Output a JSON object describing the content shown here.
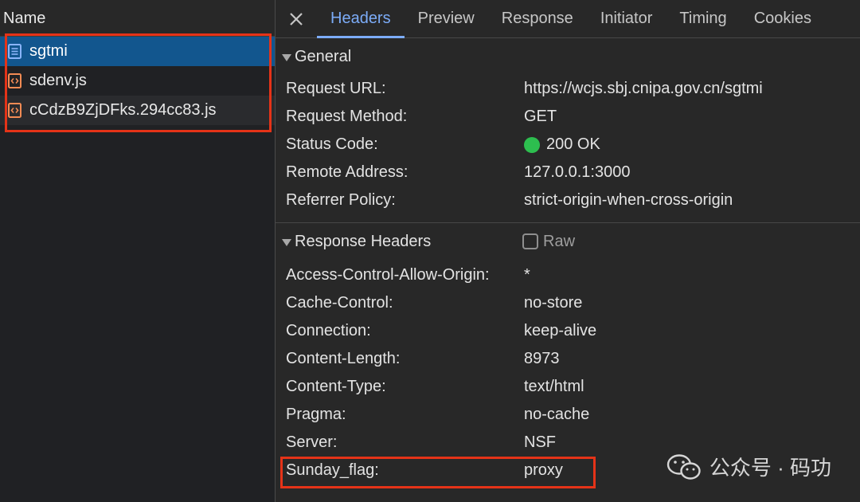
{
  "request_list": {
    "header": "Name",
    "items": [
      {
        "name": "sgtmi",
        "type": "document",
        "selected": true
      },
      {
        "name": "sdenv.js",
        "type": "script",
        "selected": false
      },
      {
        "name": "cCdzB9ZjDFks.294cc83.js",
        "type": "script",
        "selected": false
      }
    ]
  },
  "tabs": [
    {
      "label": "Headers",
      "active": true
    },
    {
      "label": "Preview",
      "active": false
    },
    {
      "label": "Response",
      "active": false
    },
    {
      "label": "Initiator",
      "active": false
    },
    {
      "label": "Timing",
      "active": false
    },
    {
      "label": "Cookies",
      "active": false
    }
  ],
  "general": {
    "title": "General",
    "rows": [
      {
        "key": "Request URL:",
        "value": "https://wcjs.sbj.cnipa.gov.cn/sgtmi"
      },
      {
        "key": "Request Method:",
        "value": "GET"
      },
      {
        "key": "Status Code:",
        "value": "200 OK"
      },
      {
        "key": "Remote Address:",
        "value": "127.0.0.1:3000"
      },
      {
        "key": "Referrer Policy:",
        "value": "strict-origin-when-cross-origin"
      }
    ]
  },
  "response_headers": {
    "title": "Response Headers",
    "raw_label": "Raw",
    "rows": [
      {
        "key": "Access-Control-Allow-Origin:",
        "value": "*"
      },
      {
        "key": "Cache-Control:",
        "value": "no-store"
      },
      {
        "key": "Connection:",
        "value": "keep-alive"
      },
      {
        "key": "Content-Length:",
        "value": "8973"
      },
      {
        "key": "Content-Type:",
        "value": "text/html"
      },
      {
        "key": "Pragma:",
        "value": "no-cache"
      },
      {
        "key": "Server:",
        "value": "NSF"
      },
      {
        "key": "Sunday_flag:",
        "value": "proxy"
      }
    ]
  },
  "colors": {
    "accent": "#7cacf8",
    "selected_row": "#12568e",
    "status_ok": "#2dbe4f",
    "annotation": "#e53318"
  },
  "icons": {
    "close": "close-icon",
    "document": "document-icon",
    "script": "script-icon",
    "wechat": "wechat-icon"
  },
  "watermark": {
    "text": "公众号 · 码功"
  }
}
